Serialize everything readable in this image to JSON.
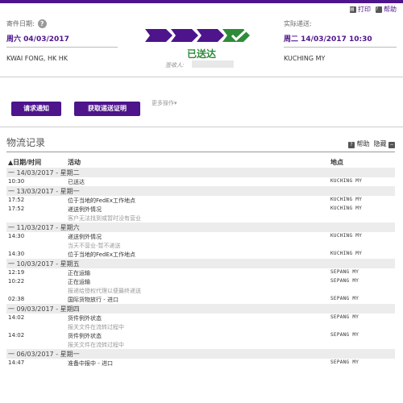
{
  "toolbar": {
    "print_label": "打印",
    "help_label": "帮助"
  },
  "ship": {
    "label": "寄件日期:",
    "day": "周六",
    "date": "04/03/2017",
    "origin": "KWAI FONG, HK HK"
  },
  "delivery": {
    "label": "实际递送:",
    "day": "周二",
    "datetime": "14/03/2017 10:30",
    "destination": "KUCHING MY"
  },
  "status": {
    "text": "已送达",
    "signed_by_label": "签收人:"
  },
  "progress": {
    "steps_complete": 4,
    "steps_total": 4
  },
  "actions": {
    "notify_button": "请求通知",
    "proof_button": "获取递送证明",
    "more_label": "更多操作▾"
  },
  "history": {
    "title": "物流记录",
    "help_label": "帮助",
    "hide_label": "隐藏",
    "columns": {
      "datetime": "▲日期/时间",
      "activity": "活动",
      "location": "地点"
    }
  },
  "rows": [
    {
      "kind": "date",
      "text": "一  14/03/2017 - 星期二"
    },
    {
      "kind": "event",
      "time": "10:30",
      "activity": "已送达",
      "location": "KUCHING MY"
    },
    {
      "kind": "date",
      "text": "一  13/03/2017 - 星期一"
    },
    {
      "kind": "event",
      "time": "17:52",
      "activity": "位于当地的FedEx工作地点",
      "location": "KUCHING MY"
    },
    {
      "kind": "event",
      "time": "17:52",
      "activity": "递送例外情况",
      "location": "KUCHING MY"
    },
    {
      "kind": "sub",
      "activity": "客户无法找到或暂时没有营业"
    },
    {
      "kind": "date",
      "text": "一  11/03/2017 - 星期六"
    },
    {
      "kind": "event",
      "time": "14:30",
      "activity": "递送例外情况",
      "location": "KUCHING MY"
    },
    {
      "kind": "sub",
      "activity": "当天不营业-暂不递送"
    },
    {
      "kind": "event",
      "time": "14:30",
      "activity": "位于当地的FedEx工作地点",
      "location": "KUCHING MY"
    },
    {
      "kind": "date",
      "text": "一  10/03/2017 - 星期五"
    },
    {
      "kind": "event",
      "time": "12:19",
      "activity": "正在运输",
      "location": "SEPANG MY"
    },
    {
      "kind": "event",
      "time": "10:22",
      "activity": "正在运输",
      "location": "SEPANG MY"
    },
    {
      "kind": "sub",
      "activity": "报递给授权代理以便最终递送"
    },
    {
      "kind": "event",
      "time": "02:38",
      "activity": "国际货物放行 - 进口",
      "location": "SEPANG MY"
    },
    {
      "kind": "date",
      "text": "一  09/03/2017 - 星期四"
    },
    {
      "kind": "event",
      "time": "14:02",
      "activity": "货件例外状态",
      "location": "SEPANG MY"
    },
    {
      "kind": "sub",
      "activity": "报关文件在流转过程中"
    },
    {
      "kind": "event",
      "time": "14:02",
      "activity": "货件例外状态",
      "location": "SEPANG MY"
    },
    {
      "kind": "sub",
      "activity": "报关文件在流转过程中"
    },
    {
      "kind": "date",
      "text": "一  06/03/2017 - 星期一"
    },
    {
      "kind": "event",
      "time": "14:47",
      "activity": "准备中报中 - 进口",
      "location": "SEPANG MY"
    }
  ],
  "colors": {
    "brand_purple": "#4d148c",
    "delivered_green": "#2e8b3a"
  }
}
